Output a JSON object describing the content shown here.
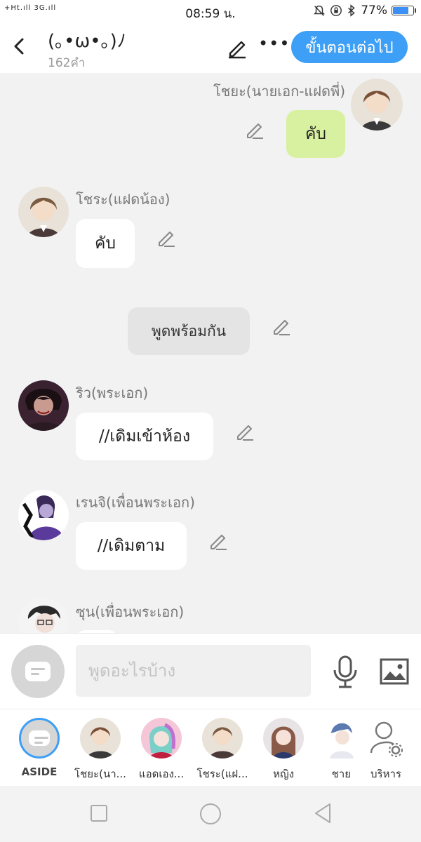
{
  "status_bar": {
    "signal": "+Ht.ıll 3G.ıll",
    "time": "08:59 น.",
    "battery": "77%",
    "battery_level": 0.77
  },
  "header": {
    "title": "(｡•ω•｡)ﾉ",
    "word_count": "162คำ",
    "next_button": "ขั้นตอนต่อไป"
  },
  "messages": [
    {
      "speaker": "โชยะ(นายเอก-แฝดพี่)",
      "text": "คับ",
      "side": "right"
    },
    {
      "speaker": "โชระ(แฝดน้อง)",
      "text": "คับ",
      "side": "left"
    },
    {
      "speaker": "",
      "text": "พูดพร้อมกัน",
      "side": "center"
    },
    {
      "speaker": "ริว(พระเอก)",
      "text": "//เดิมเข้าห้อง",
      "side": "left"
    },
    {
      "speaker": "เรนจิ(เพื่อนพระเอก)",
      "text": "//เดิมตาม",
      "side": "left"
    },
    {
      "speaker": "ซุน(เพื่อนพระเอก)",
      "text": "",
      "side": "left"
    }
  ],
  "input": {
    "placeholder": "พูดอะไรบ้าง"
  },
  "characters": [
    {
      "label": "ASIDE"
    },
    {
      "label": "โชยะ(นา..."
    },
    {
      "label": "แอดเอง..."
    },
    {
      "label": "โชระ(แฝ..."
    },
    {
      "label": "หญิง"
    },
    {
      "label": "ชาย"
    },
    {
      "label": "บริหาร"
    }
  ],
  "colors": {
    "accent": "#3d9ff5",
    "bubble_self": "#d8f1a0",
    "bubble_other": "#ffffff",
    "bubble_group": "#e4e4e4",
    "background": "#f2f2f2"
  }
}
